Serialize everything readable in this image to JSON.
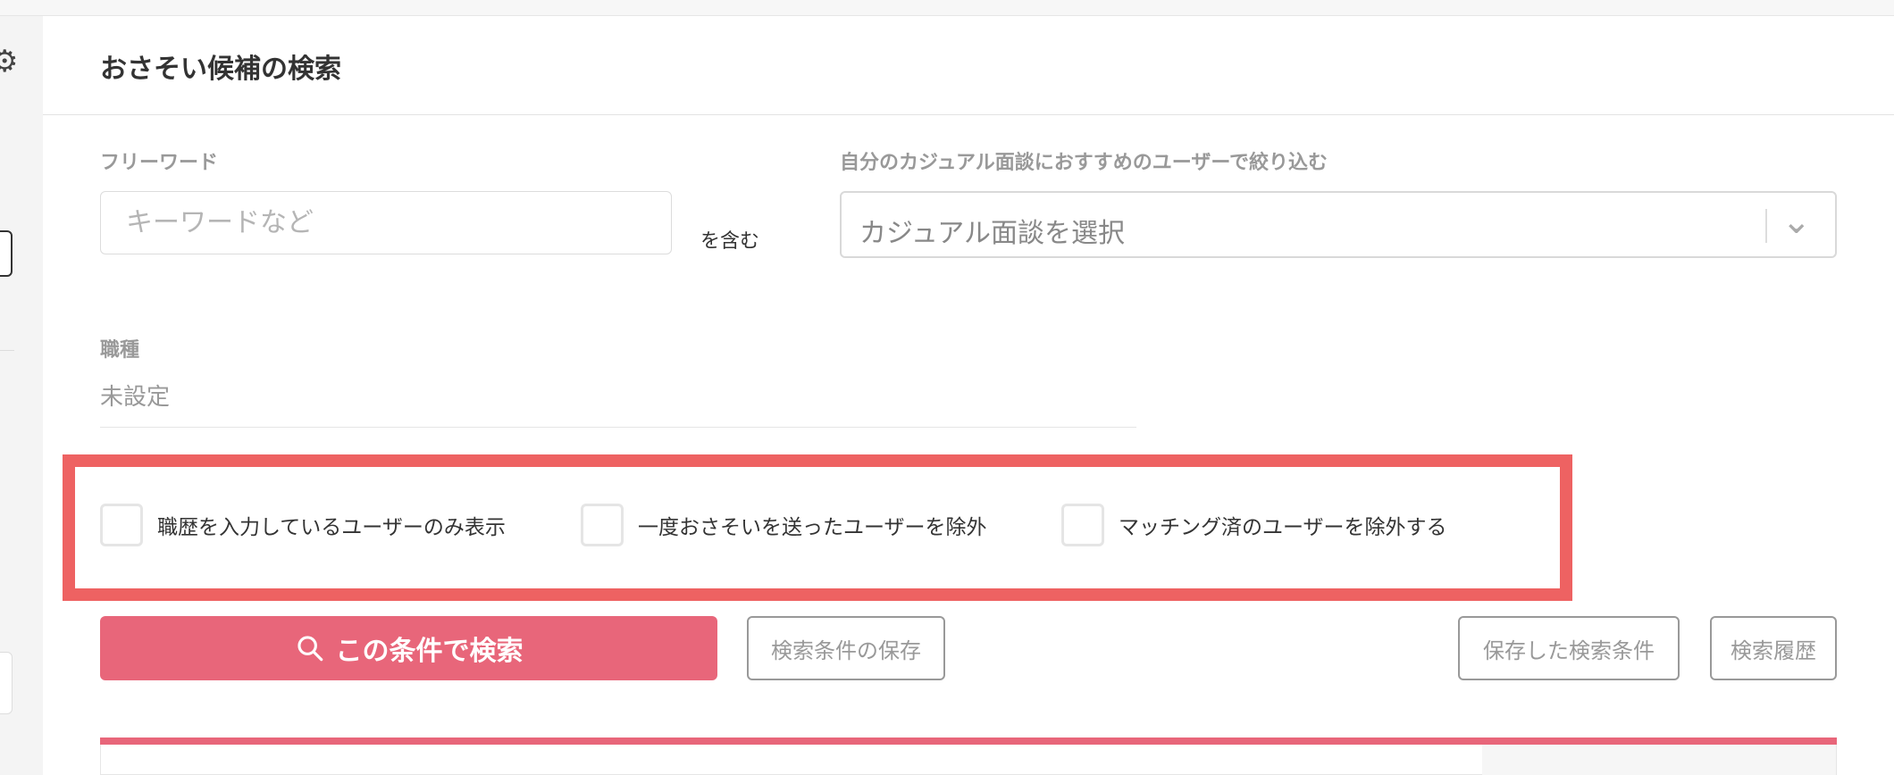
{
  "page": {
    "title": "おさそい候補の検索"
  },
  "freeword": {
    "label": "フリーワード",
    "placeholder": "キーワードなど",
    "value": "",
    "suffix": "を含む"
  },
  "casual": {
    "label": "自分のカジュアル面談におすすめのユーザーで絞り込む",
    "selected": "カジュアル面談を選択"
  },
  "job": {
    "label": "職種",
    "value": "未設定"
  },
  "filters": [
    {
      "label": "職歴を入力しているユーザーのみ表示",
      "checked": false
    },
    {
      "label": "一度おさそいを送ったユーザーを除外",
      "checked": false
    },
    {
      "label": "マッチング済のユーザーを除外する",
      "checked": false
    }
  ],
  "actions": {
    "search": "この条件で検索",
    "save": "検索条件の保存",
    "saved": "保存した検索条件",
    "history": "検索履歴"
  },
  "colors": {
    "primary": "#e8667a",
    "highlight": "#ee6262"
  },
  "icons": {
    "settings": "gear-icon",
    "search": "search-icon",
    "select": "chevron-down-icon"
  }
}
